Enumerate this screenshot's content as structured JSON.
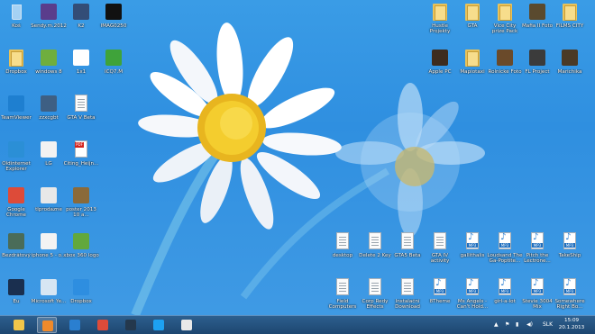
{
  "desktop": {
    "icons_left": [
      {
        "label": "Koš",
        "type": "bin"
      },
      {
        "label": "Sendy.m.2012",
        "type": "app",
        "color": "#5a3d8c"
      },
      {
        "label": "K2",
        "type": "app",
        "color": "#334d77"
      },
      {
        "label": "IMAG0250",
        "type": "app",
        "color": "#111111"
      },
      {
        "label": "Dropbox",
        "type": "folder"
      },
      {
        "label": "windows 8",
        "type": "app",
        "color": "#6fae3e"
      },
      {
        "label": "1x1",
        "type": "app",
        "color": "#ffffff"
      },
      {
        "label": "ICQ7.M",
        "type": "app",
        "color": "#3fa33a"
      },
      {
        "label": "TeamViewer",
        "type": "app",
        "color": "#1e7fd0"
      },
      {
        "label": "zzxcgbt",
        "type": "app",
        "color": "#3e5f83"
      },
      {
        "label": "GTA V Beta",
        "type": "doc"
      },
      {
        "label": "Oldinternet Explorer",
        "type": "app",
        "color": "#2b8fd6"
      },
      {
        "label": "LG",
        "type": "app",
        "color": "#f2f2f2"
      },
      {
        "label": "Citing_Heijn...",
        "type": "pdf"
      },
      {
        "label": "Google Chrome",
        "type": "app",
        "color": "#dd4b39"
      },
      {
        "label": "tlprodazne",
        "type": "app",
        "color": "#e8e8e8"
      },
      {
        "label": "poster 2013 10 a...",
        "type": "app",
        "color": "#8a6a3a"
      },
      {
        "label": "Bezdrátový",
        "type": "app",
        "color": "#4a6c58"
      },
      {
        "label": "iphone 5 - o...",
        "type": "app",
        "color": "#f3f3f3"
      },
      {
        "label": "xbox 360 logo",
        "type": "app",
        "color": "#62a83c"
      },
      {
        "label": "Eu",
        "type": "app",
        "color": "#1a2f4f"
      },
      {
        "label": "Microsoft Ye...",
        "type": "app",
        "color": "#d7e6f3"
      },
      {
        "label": "Dropbox",
        "type": "app",
        "color": "#2e8ee0"
      }
    ],
    "icons_right_top": [
      {
        "label": "Hustle Projekty",
        "type": "folder"
      },
      {
        "label": "GTA",
        "type": "folder"
      },
      {
        "label": "Vice City prize Pack",
        "type": "folder"
      },
      {
        "label": "Mafia II Foto",
        "type": "app",
        "color": "#5a4a2e"
      },
      {
        "label": "FILMS CITY",
        "type": "folder"
      },
      {
        "label": "Apple PC",
        "type": "app",
        "color": "#3d2c1e"
      },
      {
        "label": "Mapiotaxi",
        "type": "folder"
      },
      {
        "label": "Rolnické Foto",
        "type": "app",
        "color": "#6a4a2a"
      },
      {
        "label": "FL Project",
        "type": "app",
        "color": "#3b3b3b"
      },
      {
        "label": "Marichika",
        "type": "app",
        "color": "#4a3a26"
      }
    ],
    "icons_right_bottom": [
      {
        "label": "desktop",
        "type": "doc"
      },
      {
        "label": "Delete 2 Key",
        "type": "doc"
      },
      {
        "label": "GTA5 Beta",
        "type": "doc"
      },
      {
        "label": "GTA IV activity",
        "type": "doc"
      },
      {
        "label": "gallithalis",
        "type": "audio"
      },
      {
        "label": "Loudsand The Ga-Poptite...",
        "type": "audio"
      },
      {
        "label": "Pitch the Lectrone...",
        "type": "audio"
      },
      {
        "label": "TakeShip",
        "type": "audio"
      },
      {
        "label": "Field Computers",
        "type": "doc"
      },
      {
        "label": "Corp Redy Effects",
        "type": "doc"
      },
      {
        "label": "Instalační Download",
        "type": "doc"
      },
      {
        "label": "8Theme",
        "type": "audio"
      },
      {
        "label": "Ms Angels - Can't Hold...",
        "type": "audio"
      },
      {
        "label": "girl-a-lot",
        "type": "audio"
      },
      {
        "label": "Stevie 3004 Mix",
        "type": "audio"
      },
      {
        "label": "Somewhere Right Bo...",
        "type": "audio"
      }
    ]
  },
  "taskbar": {
    "buttons": [
      {
        "name": "file-explorer",
        "color": "#f1c64a",
        "active": false
      },
      {
        "name": "media-player",
        "color": "#f08a2a",
        "active": true
      },
      {
        "name": "windows-media-player",
        "color": "#2a7fd0",
        "active": false
      },
      {
        "name": "chrome",
        "color": "#dd4b39",
        "active": false
      },
      {
        "name": "steam",
        "color": "#24384d",
        "active": false
      },
      {
        "name": "skype",
        "color": "#1da1f2",
        "active": false
      },
      {
        "name": "paint",
        "color": "#e9e9e9",
        "active": false
      }
    ],
    "language": "SLK",
    "time": "15:09",
    "date": "20.1.2013"
  }
}
